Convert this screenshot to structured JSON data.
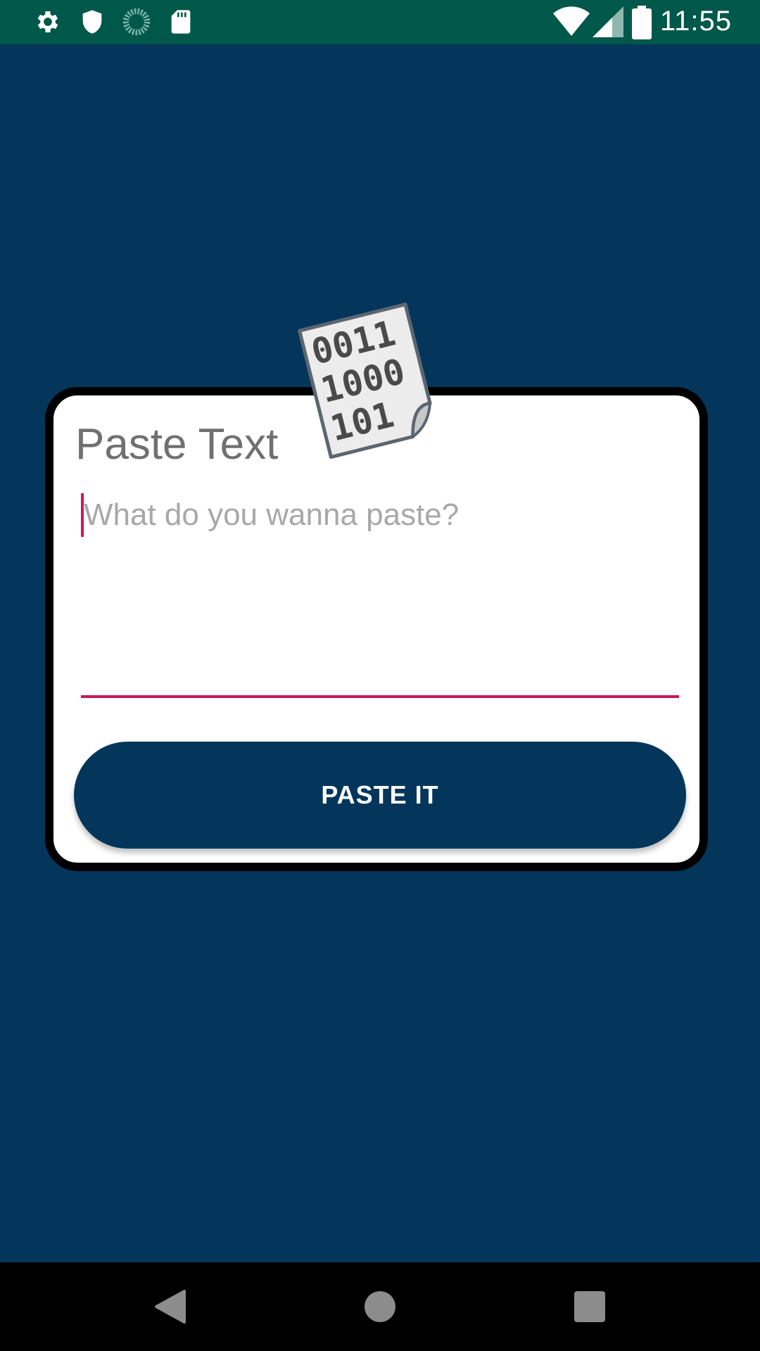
{
  "status_bar": {
    "time": "11:55",
    "left_icons": [
      "gear-icon",
      "shield-icon",
      "sync-icon",
      "sd-card-icon"
    ],
    "right_icons": [
      "wifi-icon",
      "signal-icon",
      "battery-icon"
    ],
    "color": "#00584a"
  },
  "card": {
    "title": "Paste Text",
    "logo_text": [
      "0011",
      "1000",
      "101"
    ],
    "input": {
      "placeholder": "What do you wanna paste?",
      "value": ""
    },
    "button_label": "PASTE IT"
  },
  "colors": {
    "background": "#03365a",
    "accent": "#c8195a",
    "button": "#03365a"
  },
  "nav_bar": {
    "icons": [
      "back-icon",
      "home-icon",
      "recents-icon"
    ]
  }
}
